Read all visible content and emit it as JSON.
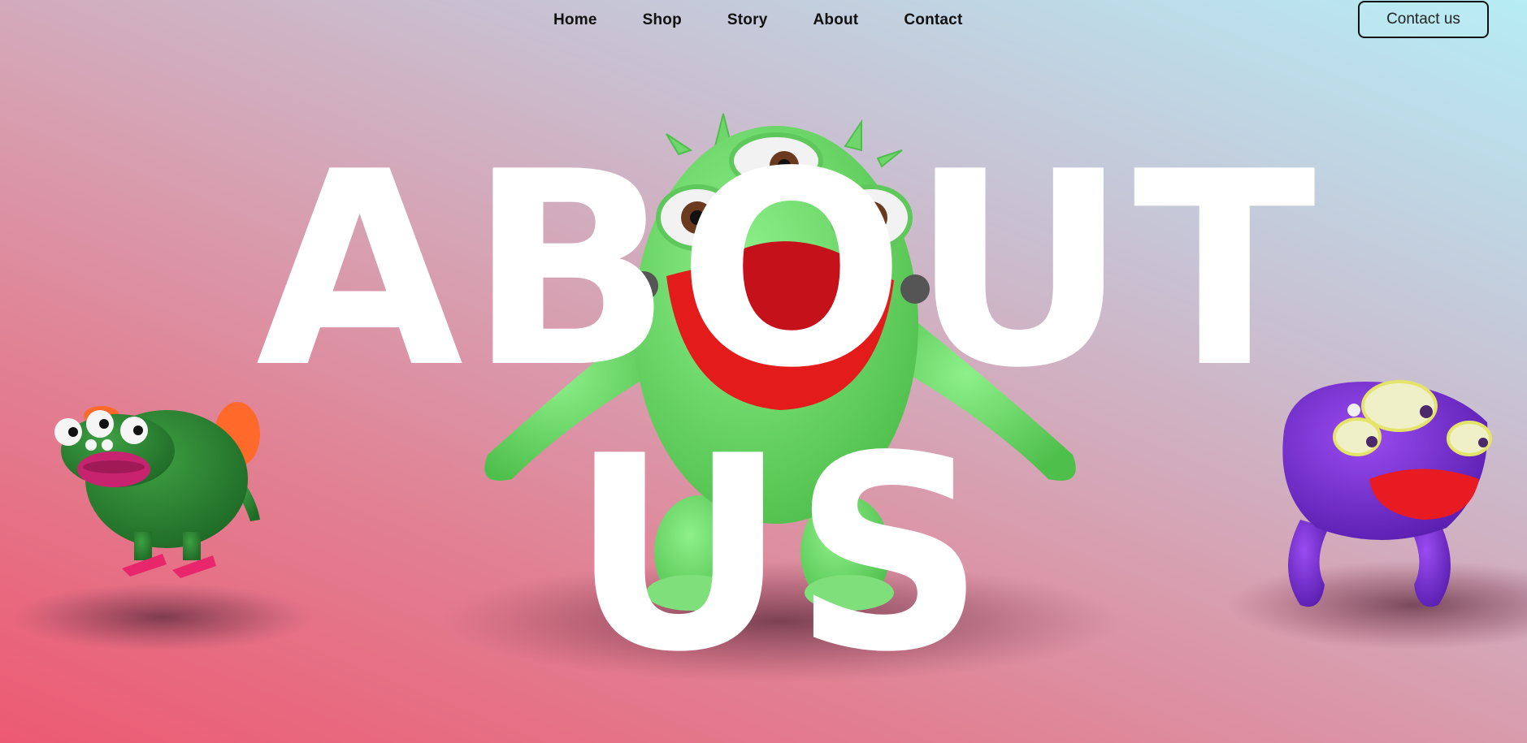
{
  "nav": {
    "links": [
      "Home",
      "Shop",
      "Story",
      "About",
      "Contact"
    ],
    "contact_button": "Contact us"
  },
  "hero": {
    "line1": "ABOUT",
    "line2": "US"
  },
  "characters": [
    {
      "name": "green-frog-monster",
      "color": "#2e8b34"
    },
    {
      "name": "light-green-cyclops-monster",
      "color": "#6fd66b"
    },
    {
      "name": "purple-octopus-monster",
      "color": "#7b2fd6"
    }
  ]
}
